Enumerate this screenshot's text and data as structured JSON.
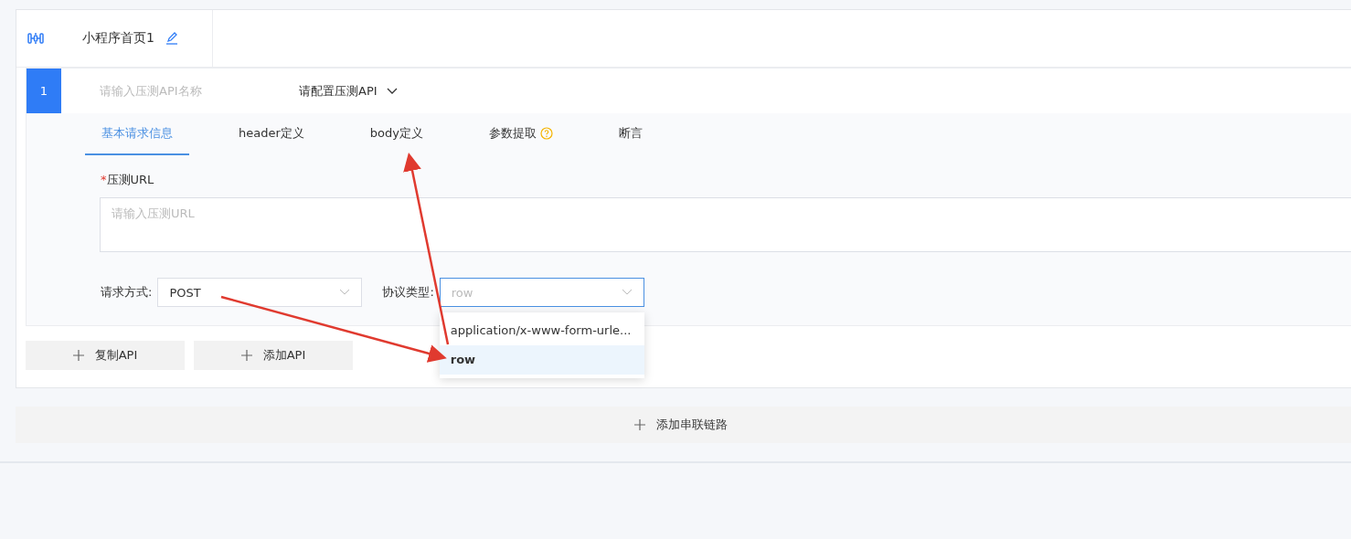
{
  "flow": {
    "title": "小程序首页1"
  },
  "api": {
    "index": "1",
    "name_placeholder": "请输入压测API名称",
    "api_select": "请配置压测API"
  },
  "tabs": [
    {
      "label": "基本请求信息",
      "selected": true,
      "help": false
    },
    {
      "label": "header定义",
      "selected": false,
      "help": false
    },
    {
      "label": "body定义",
      "selected": false,
      "help": false
    },
    {
      "label": "参数提取",
      "selected": false,
      "help": true
    },
    {
      "label": "断言",
      "selected": false,
      "help": false
    }
  ],
  "url": {
    "label": "压测URL",
    "required_mark": "*",
    "placeholder": "请输入压测URL"
  },
  "method": {
    "label": "请求方式:",
    "value": "POST"
  },
  "protocol": {
    "label": "协议类型:",
    "placeholder": "row",
    "open": true,
    "options": [
      {
        "label": "application/x-www-form-urle...",
        "selected": false
      },
      {
        "label": "row",
        "selected": true
      }
    ]
  },
  "buttons": [
    {
      "label": "复制API"
    },
    {
      "label": "添加API"
    }
  ],
  "add_chain": {
    "label": "添加串联链路"
  }
}
